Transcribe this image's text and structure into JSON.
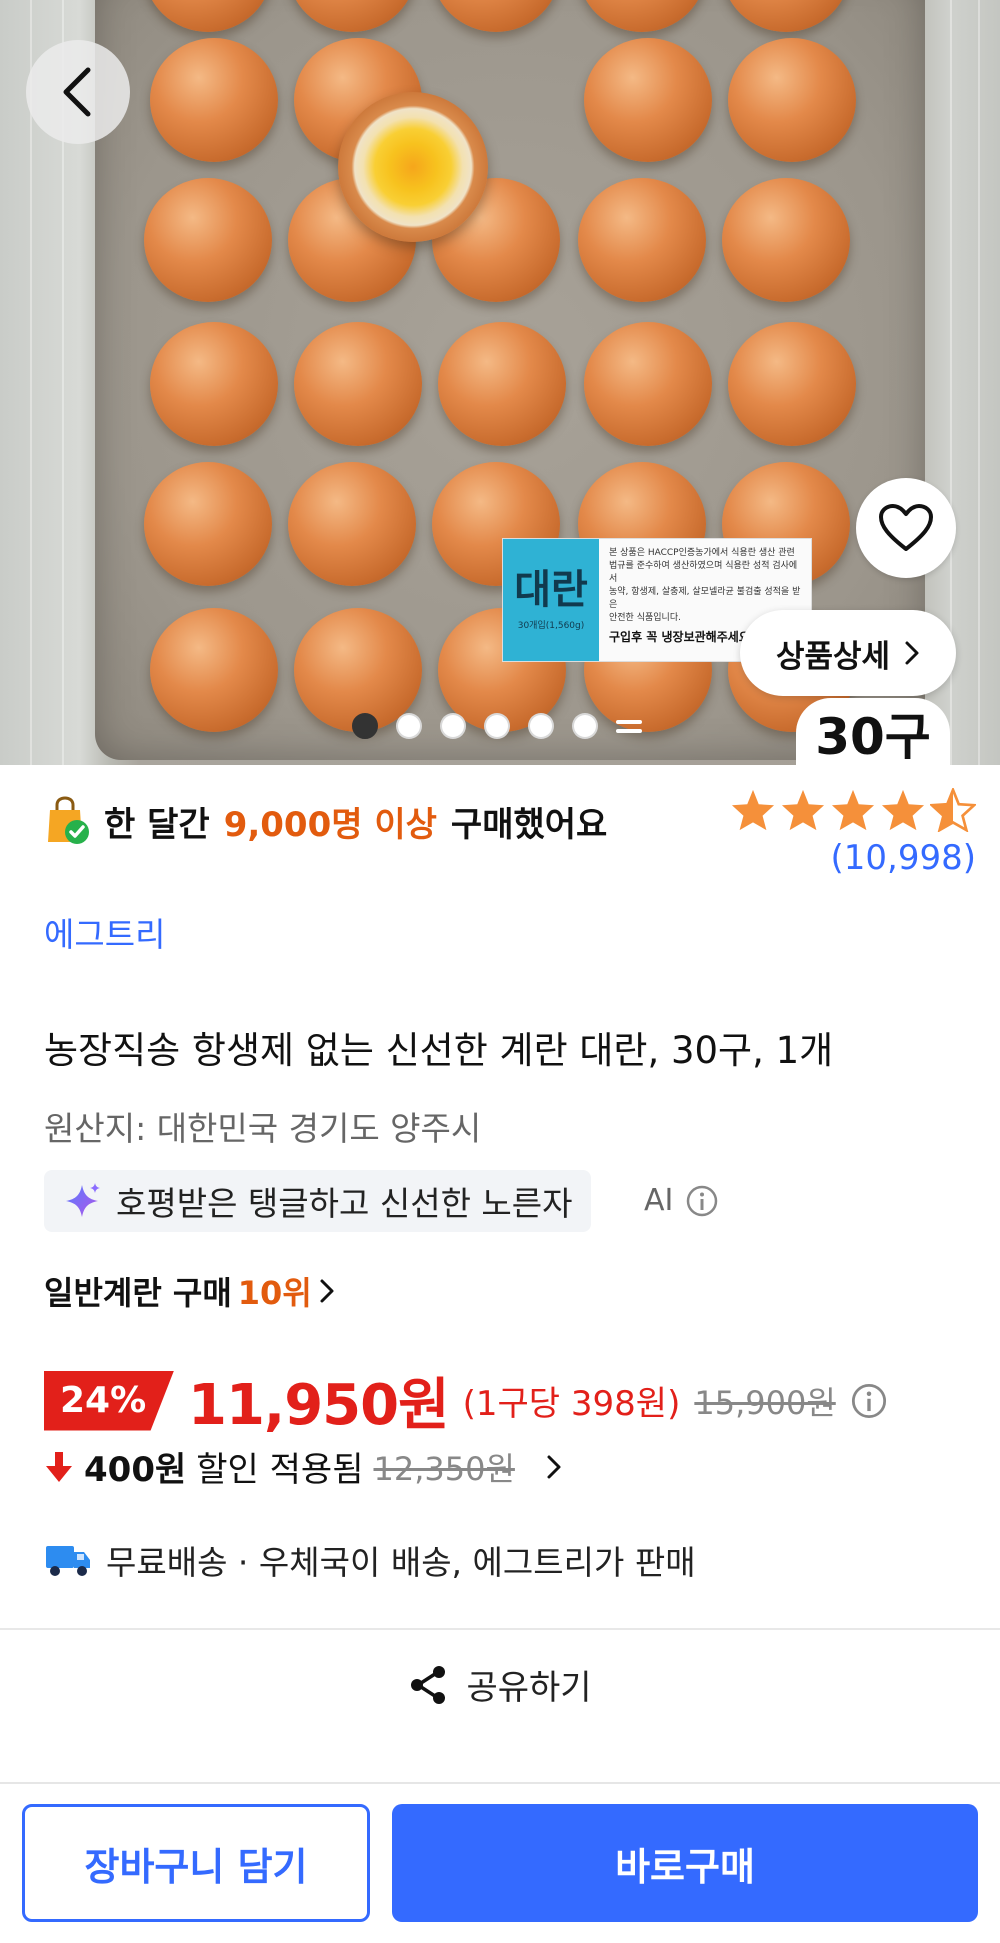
{
  "hero": {
    "label_big": "대란",
    "label_sub": "30개입(1,560g)",
    "label_lines": [
      "본 상품은 HACCP인증농가에서 식용란 생산 관련",
      "법규를 준수하여 생산하였으며 식용란 성적 검사에서",
      "농약, 항생제, 살충제, 살모넬라균 불검출 성적을 받은",
      "안전한 식품입니다."
    ],
    "label_warn": "구입후 꼭 냉장보관해주세요!",
    "detail_label": "상품상세",
    "count_badge": "30구",
    "slide_index": 1,
    "slide_total": 7
  },
  "purchase": {
    "prefix": "한 달간",
    "highlight": "9,000명 이상",
    "suffix": "구매했어요"
  },
  "rating": {
    "stars": 4.5,
    "review_count": "(10,998)"
  },
  "seller": "에그트리",
  "product": {
    "title": "농장직송 항생제 없는 신선한 계란 대란, 30구, 1개",
    "origin": "원산지: 대한민국 경기도 양주시"
  },
  "ai_summary": {
    "text": "호평받은 탱글하고 신선한 노른자",
    "tag": "AI"
  },
  "rank": {
    "label": "일반계란 구매",
    "value": "10위"
  },
  "price": {
    "discount": "24%",
    "sale": "11,950원",
    "unit": "(1구당 398원)",
    "original": "15,900원"
  },
  "coupon": {
    "amount": "400원",
    "label": "할인 적용됨",
    "previous": "12,350원"
  },
  "shipping": {
    "text": "무료배송 · 우체국이 배송, 에그트리가 판매"
  },
  "share": {
    "label": "공유하기"
  },
  "actions": {
    "cart": "장바구니 담기",
    "buy": "바로구매"
  },
  "colors": {
    "accent_blue": "#346aff",
    "sale_red": "#e2201a",
    "highlight_orange": "#e25b0e",
    "star": "#f5903a"
  }
}
